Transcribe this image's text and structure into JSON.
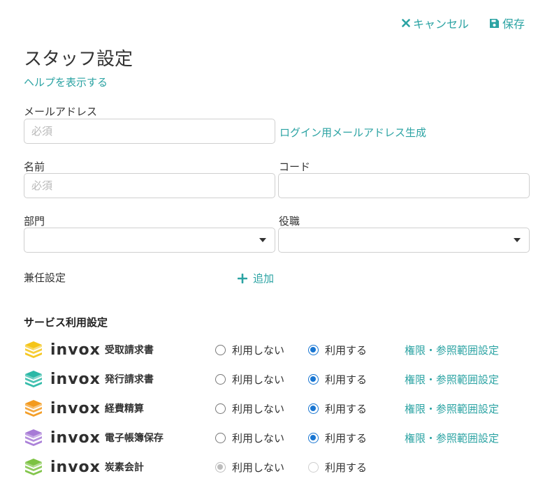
{
  "colors": {
    "accent": "#2ba3a3",
    "radio": "#1976d2"
  },
  "toolbar": {
    "cancel_label": "キャンセル",
    "save_label": "保存"
  },
  "page": {
    "title": "スタッフ設定",
    "help_link": "ヘルプを表示する"
  },
  "form": {
    "email": {
      "label": "メールアドレス",
      "placeholder": "必須",
      "value": "",
      "generate_link": "ログイン用メールアドレス生成"
    },
    "name": {
      "label": "名前",
      "placeholder": "必須",
      "value": ""
    },
    "code": {
      "label": "コード",
      "value": ""
    },
    "department": {
      "label": "部門",
      "value": ""
    },
    "position": {
      "label": "役職",
      "value": ""
    },
    "concurrent": {
      "label": "兼任設定",
      "add_label": "追加"
    }
  },
  "services": {
    "section_title": "サービス利用設定",
    "brand": "invox",
    "option_off": "利用しない",
    "option_on": "利用する",
    "perm_link": "権限・参照範囲設定",
    "items": [
      {
        "name": "受取請求書",
        "icon": "stack-yellow-icon",
        "color": "#f5c518",
        "selected": "on",
        "disabled": false,
        "has_perm": true
      },
      {
        "name": "発行請求書",
        "icon": "stack-teal-icon",
        "color": "#2bb8a6",
        "selected": "on",
        "disabled": false,
        "has_perm": true
      },
      {
        "name": "経費精算",
        "icon": "stack-orange-icon",
        "color": "#f39a1e",
        "selected": "on",
        "disabled": false,
        "has_perm": true
      },
      {
        "name": "電子帳簿保存",
        "icon": "stack-purple-icon",
        "color": "#a77ad6",
        "selected": "on",
        "disabled": false,
        "has_perm": true
      },
      {
        "name": "炭素会計",
        "icon": "stack-green-icon",
        "color": "#7cc242",
        "selected": "off",
        "disabled": true,
        "has_perm": false
      }
    ]
  }
}
